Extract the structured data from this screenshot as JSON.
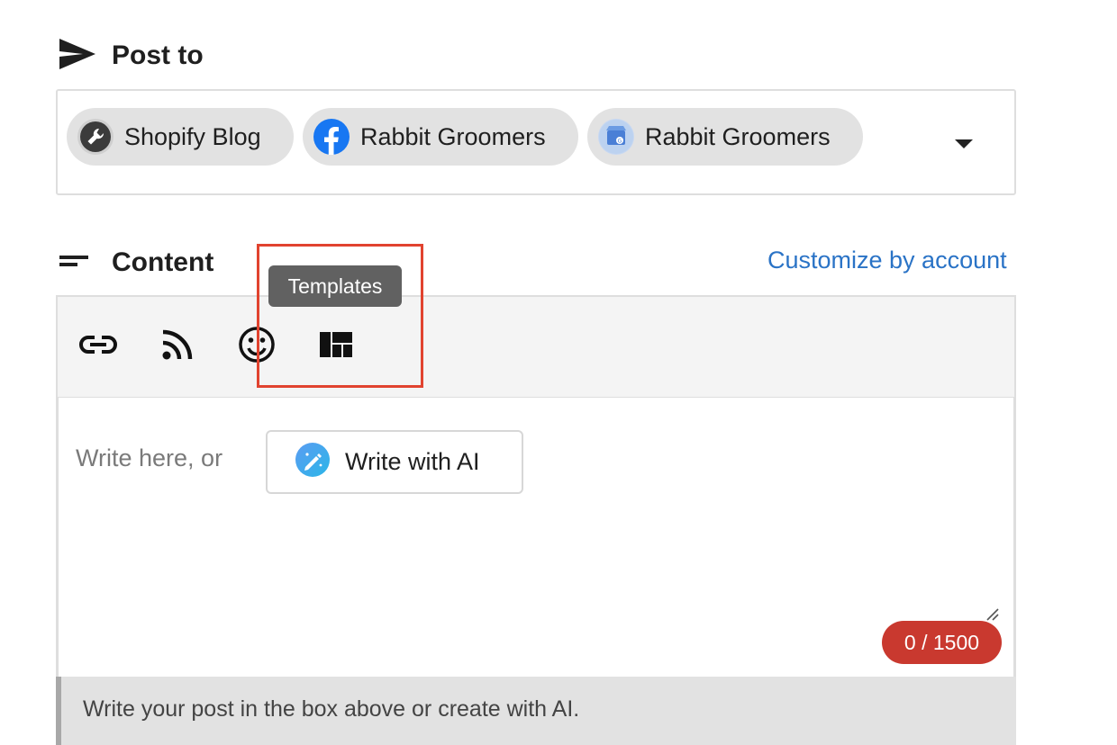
{
  "post_to": {
    "title": "Post to",
    "icon": "send-icon",
    "accounts": [
      {
        "label": "Shopify Blog",
        "icon": "shopify-wrench-icon"
      },
      {
        "label": "Rabbit Groomers",
        "icon": "facebook-icon"
      },
      {
        "label": "Rabbit Groomers",
        "icon": "google-business-icon"
      }
    ],
    "dropdown_icon": "chevron-down-icon"
  },
  "content": {
    "title": "Content",
    "icon": "short-text-icon",
    "customize_link": "Customize by account",
    "toolbar": {
      "tools": [
        "link-icon",
        "rss-icon",
        "emoji-icon",
        "templates-icon"
      ],
      "tooltip": "Templates"
    },
    "editor": {
      "placeholder": "Write here, or",
      "ai_button_label": "Write with AI",
      "char_count": "0 / 1500"
    },
    "hint": "Write your post in the box above or create with AI."
  },
  "colors": {
    "accent_link": "#2a73c6",
    "counter_bg": "#c9392f",
    "highlight": "#e1432f",
    "facebook": "#1877f2"
  }
}
